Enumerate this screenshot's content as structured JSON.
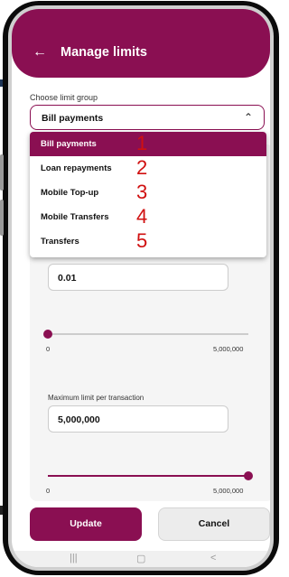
{
  "header": {
    "title": "Manage limits",
    "back_icon": "arrow-left-icon"
  },
  "limit_group": {
    "label": "Choose limit group",
    "selected": "Bill payments"
  },
  "dropdown": {
    "options": [
      {
        "label": "Bill payments",
        "marker": "1"
      },
      {
        "label": "Loan repayments",
        "marker": "2"
      },
      {
        "label": "Mobile Top-up",
        "marker": "3"
      },
      {
        "label": "Mobile Transfers",
        "marker": "4"
      },
      {
        "label": "Transfers",
        "marker": "5"
      }
    ]
  },
  "min_limit": {
    "value": "0.01",
    "slider_min": "0",
    "slider_max": "5,000,000",
    "level_fraction": 0.0
  },
  "max_limit": {
    "label": "Maximum limit per transaction",
    "value": "5,000,000",
    "slider_min": "0",
    "slider_max": "5,000,000",
    "level_fraction": 1.0
  },
  "actions": {
    "update": "Update",
    "cancel": "Cancel"
  },
  "colors": {
    "brand": "#8a0f52",
    "marker": "#d01010"
  }
}
